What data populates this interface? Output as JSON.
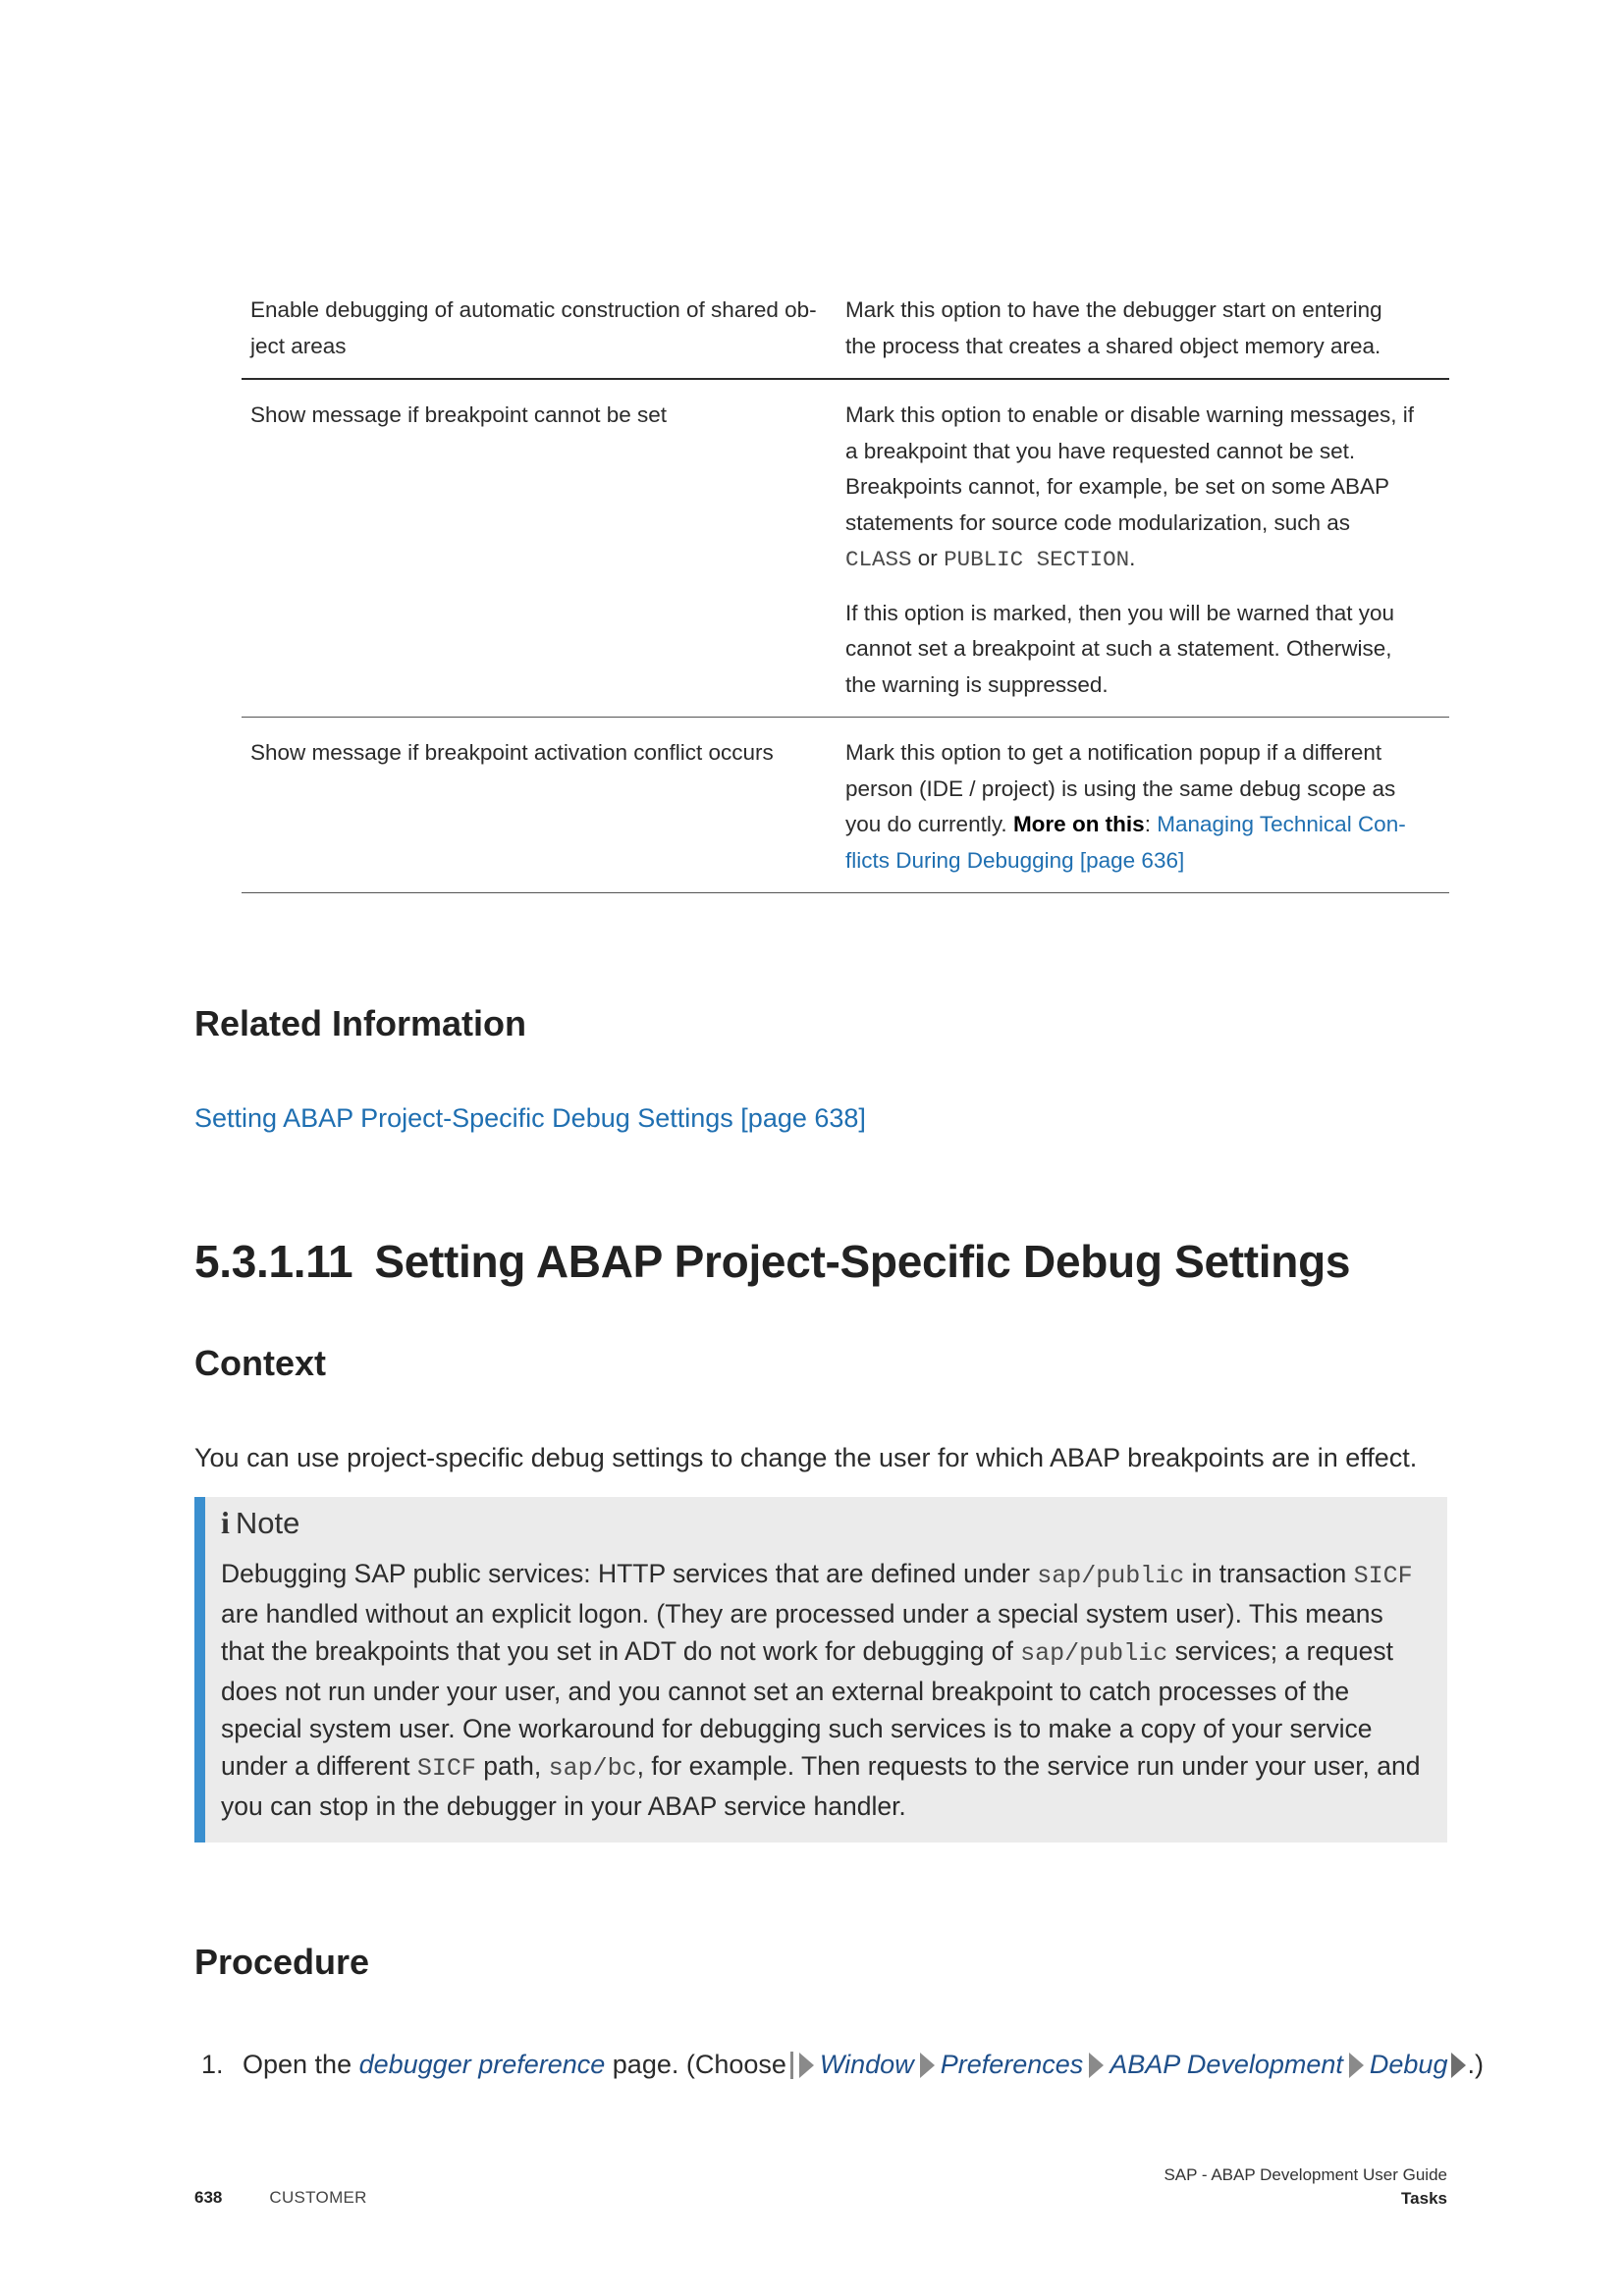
{
  "options_table": {
    "rows": [
      {
        "name": "Enable debugging of automatic construction of shared ob-ject areas",
        "name_lines": [
          "Enable debugging of automatic construction of shared ob-",
          "ject areas"
        ],
        "desc_lines": [
          "Mark this option to have the debugger start on entering",
          "the process that creates a shared object memory area."
        ]
      },
      {
        "name": "Show message if breakpoint cannot be set",
        "desc_p1_lines": [
          "Mark this option to enable or disable warning messages, if",
          "a breakpoint that you have requested cannot be set.",
          "Breakpoints cannot, for example, be set on some ABAP",
          "statements for source code modularization, such as"
        ],
        "code1": "CLASS",
        "or_text": "or",
        "code2": "PUBLIC SECTION",
        "end_dot": ".",
        "desc_p2_lines": [
          "If this option is marked, then you will be warned that you",
          "cannot set a breakpoint at such a statement. Otherwise,",
          "the warning is suppressed."
        ]
      },
      {
        "name": "Show message if breakpoint activation conflict occurs",
        "desc_lines": [
          "Mark this option to get a notification popup if a different",
          "person (IDE / project) is using the same debug scope as"
        ],
        "desc_line3_prefix": "you do currently.",
        "more_label": "More on this",
        "colon": ":",
        "link_part1": "Managing Technical Con-",
        "link_part2": "flicts During Debugging [page 636]"
      }
    ]
  },
  "related": {
    "heading": "Related Information",
    "link": "Setting ABAP Project-Specific Debug Settings [page 638]"
  },
  "section": {
    "number": "5.3.1.11",
    "title": "Setting ABAP Project-Specific Debug Settings",
    "context_heading": "Context",
    "context_text": "You can use project-specific debug settings to change the user for which ABAP breakpoints are in effect."
  },
  "note": {
    "icon": "info-icon",
    "icon_glyph": "i",
    "title": "Note",
    "t1": "Debugging SAP public services: HTTP services that are defined under ",
    "c1": "sap/public",
    "t2": " in transaction ",
    "c2": "SICF",
    "t3": " are handled without an explicit logon. (They are processed under a special system user). This means that the breakpoints that you set in ADT do not work for debugging of ",
    "c3": "sap/public",
    "t4": " services; a request does not run under your user, and you cannot set an external breakpoint to catch processes of the special system user. One workaround for debugging such services is to make a copy of your service under a different ",
    "c4": "SICF",
    "t5": " path, ",
    "c5": "sap/bc",
    "t6": ", for example. Then requests to the service run under your user, and you can stop in the debugger in your ABAP service handler."
  },
  "procedure": {
    "heading": "Procedure",
    "step1": {
      "number": "1.",
      "prefix": "Open the ",
      "emph": "debugger preference",
      "middle": " page. (Choose ",
      "menu": [
        "Window",
        "Preferences",
        "ABAP Development",
        "Debug"
      ],
      "suffix": ".)"
    }
  },
  "footer": {
    "page_number": "638",
    "confidentiality": "CUSTOMER",
    "doc_title": "SAP - ABAP Development User Guide",
    "chapter": "Tasks"
  },
  "colors": {
    "link": "#1f6fb1",
    "note_bar": "#3a8fcf",
    "note_bg": "#ebebeb",
    "menu_path": "#1e4f8a"
  }
}
